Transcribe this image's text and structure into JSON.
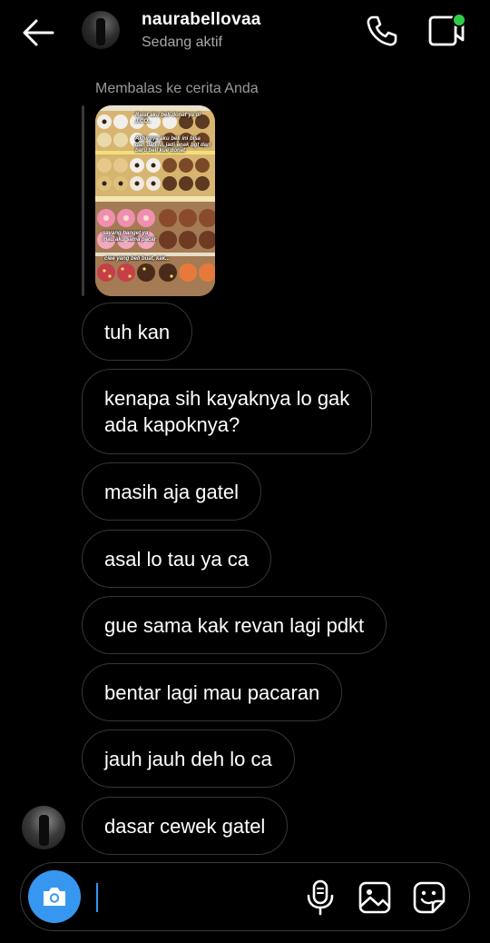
{
  "header": {
    "username": "naurabellovaa",
    "status": "Sedang aktif",
    "icons": {
      "back": "arrow-left-icon",
      "call": "phone-icon",
      "video": "video-call-icon"
    },
    "online_color": "#2fcc47"
  },
  "story_reply": {
    "label": "Membalas ke cerita Anda",
    "captions": [
      "Ralat aku beli donat ya di J.CO..",
      "Akhirnya aku beli ini bisa dan dari lu, jadi enak bgt dari baru beli kue donat",
      "sayang banget ya mau aku sama pacar",
      "ciee yang beli buat, kak..."
    ]
  },
  "messages": [
    {
      "lines": [
        "tuh kan"
      ]
    },
    {
      "lines": [
        "kenapa sih kayaknya lo gak",
        "ada kapoknya?"
      ]
    },
    {
      "lines": [
        "masih aja gatel"
      ]
    },
    {
      "lines": [
        "asal lo tau ya ca"
      ]
    },
    {
      "lines": [
        "gue sama kak revan lagi pdkt"
      ]
    },
    {
      "lines": [
        "bentar lagi mau pacaran"
      ]
    },
    {
      "lines": [
        "jauh jauh deh lo ca"
      ]
    },
    {
      "lines": [
        "dasar cewek gatel"
      ]
    }
  ],
  "composer": {
    "value": "",
    "icons": {
      "camera": "camera-icon",
      "mic": "microphone-icon",
      "gallery": "image-gallery-icon",
      "sticker": "sticker-icon"
    },
    "accent": "#3797f0"
  }
}
